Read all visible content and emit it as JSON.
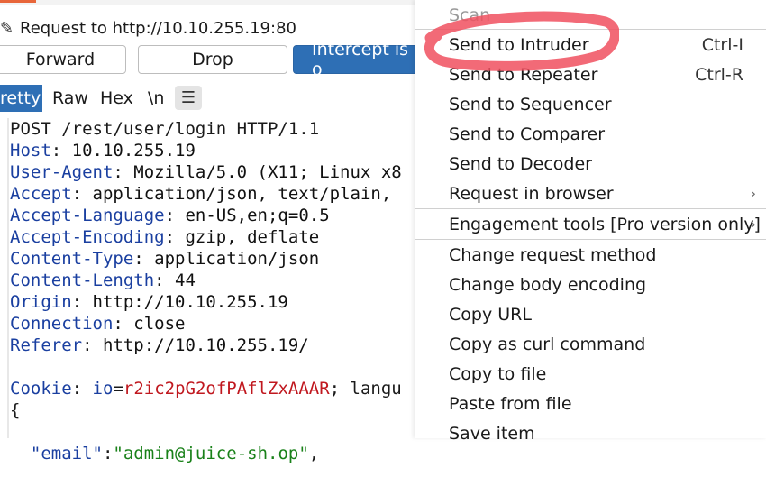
{
  "request_line": "Request to http://10.10.255.19:80",
  "buttons": {
    "forward": "Forward",
    "drop": "Drop",
    "intercept": "Intercept is o"
  },
  "tabs": {
    "pretty": "retty",
    "raw": "Raw",
    "hex": "Hex",
    "newline": "\\n",
    "menu_glyph": "☰"
  },
  "request": {
    "start_line": "POST /rest/user/login HTTP/1.1",
    "headers": [
      {
        "name": "Host",
        "value": "10.10.255.19"
      },
      {
        "name": "User-Agent",
        "value": "Mozilla/5.0 (X11; Linux x8"
      },
      {
        "name": "Accept",
        "value": "application/json, text/plain,"
      },
      {
        "name": "Accept-Language",
        "value": "en-US,en;q=0.5"
      },
      {
        "name": "Accept-Encoding",
        "value": "gzip, deflate"
      },
      {
        "name": "Content-Type",
        "value": "application/json"
      },
      {
        "name": "Content-Length",
        "value": "44"
      },
      {
        "name": "Origin",
        "value": "http://10.10.255.19"
      },
      {
        "name": "Connection",
        "value": "close"
      },
      {
        "name": "Referer",
        "value": "http://10.10.255.19/"
      }
    ],
    "cookie": {
      "name": "Cookie",
      "key": "io",
      "value": "r2ic2pG2ofPAflZxAAAR",
      "rest": "; langu"
    },
    "brace": "{",
    "email_key": "\"email\"",
    "email_value": "\"admin@juice-sh.op\"",
    "email_tail": ","
  },
  "menu": {
    "items": [
      {
        "label": "Scan",
        "shortcut": "",
        "disabled": true
      },
      {
        "label": "Send to Intruder",
        "shortcut": "Ctrl-I"
      },
      {
        "label": "Send to Repeater",
        "shortcut": "Ctrl-R"
      },
      {
        "label": "Send to Sequencer",
        "shortcut": ""
      },
      {
        "label": "Send to Comparer",
        "shortcut": ""
      },
      {
        "label": "Send to Decoder",
        "shortcut": ""
      },
      {
        "label": "Request in browser",
        "shortcut": "",
        "submenu": true
      },
      {
        "label": "Engagement tools [Pro version only]",
        "shortcut": "",
        "submenu": true
      },
      {
        "label": "Change request method",
        "shortcut": ""
      },
      {
        "label": "Change body encoding",
        "shortcut": ""
      },
      {
        "label": "Copy URL",
        "shortcut": ""
      },
      {
        "label": "Copy as curl command",
        "shortcut": ""
      },
      {
        "label": "Copy to file",
        "shortcut": ""
      },
      {
        "label": "Paste from file",
        "shortcut": ""
      },
      {
        "label": "Save item",
        "shortcut": ""
      }
    ],
    "submenu_arrow": "›"
  },
  "edge_cut": {
    "ua_tail": "L",
    "cookie_tail": "s"
  },
  "colors": {
    "accent_blue": "#2e6fb5",
    "header_name": "#1a3fa0",
    "cookie_value": "#c0181f",
    "json_string": "#198119",
    "highlight": "#f0505f"
  }
}
